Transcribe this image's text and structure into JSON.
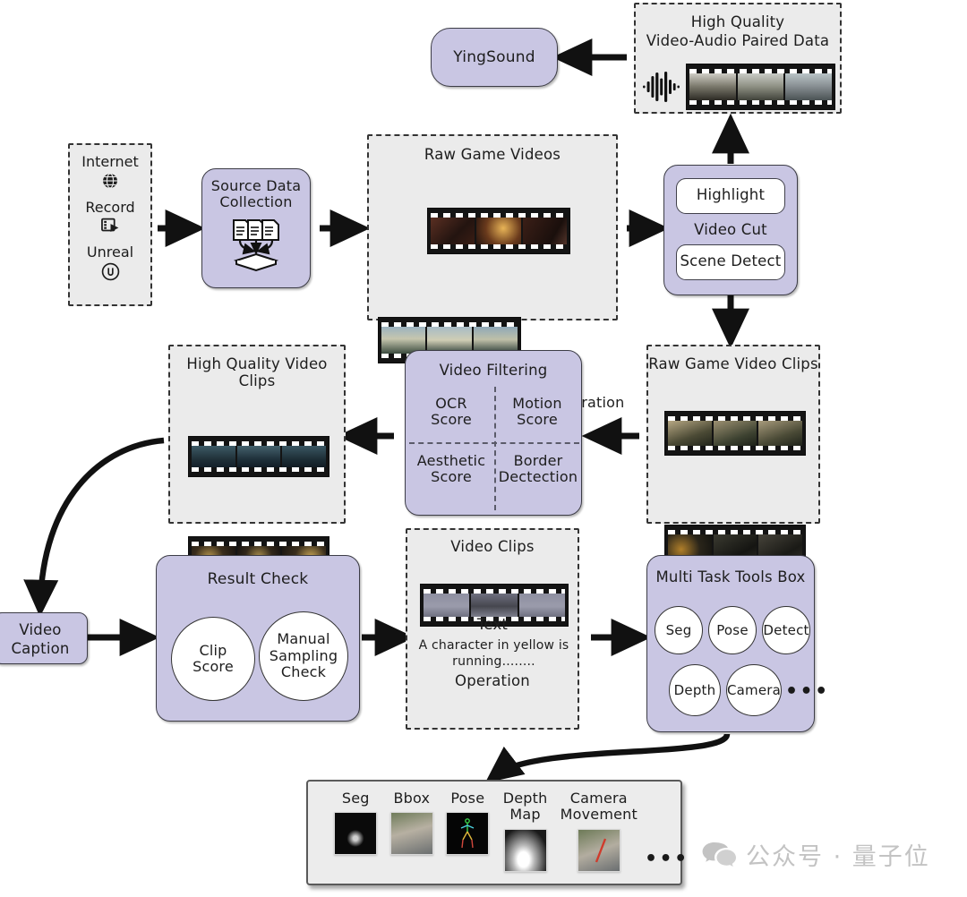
{
  "title": "Game video data production pipeline",
  "colors": {
    "purple": "#c9c6e3",
    "panel_grey": "#ebebeb",
    "stroke": "#333333",
    "text": "#1d1d1d"
  },
  "source_data": {
    "items": [
      {
        "label": "Internet",
        "icon": "globe-icon"
      },
      {
        "label": "Record",
        "icon": "screen-record-icon"
      },
      {
        "label": "Unreal",
        "icon": "unreal-engine-icon"
      }
    ]
  },
  "source_collection": {
    "label_line1": "Source Data",
    "label_line2": "Collection",
    "icon": "documents-to-tray-icon"
  },
  "raw_game_videos": {
    "title": "Raw Game Videos",
    "operation_label": "Operation",
    "operation_icon": "plus-icon"
  },
  "video_cut": {
    "title": "Video Cut",
    "highlight": "Highlight",
    "scene_detect": "Scene Detect"
  },
  "paired_data": {
    "title_line1": "High Quality",
    "title_line2": "Video-Audio Paired Data",
    "audio_icon": "waveform-icon"
  },
  "yingsound": {
    "label": "YingSound"
  },
  "raw_clips": {
    "title": "Raw Game Video Clips"
  },
  "video_filtering": {
    "title": "Video Filtering",
    "cells": [
      {
        "line1": "OCR",
        "line2": "Score"
      },
      {
        "line1": "Motion",
        "line2": "Score"
      },
      {
        "line1": "Aesthetic",
        "line2": "Score"
      },
      {
        "line1": "Border",
        "line2": "Dectection"
      }
    ]
  },
  "hq_clips": {
    "title": "High Quality Video Clips"
  },
  "video_caption": {
    "line1": "Video",
    "line2": "Caption"
  },
  "result_check": {
    "title": "Result Check",
    "circles": [
      {
        "lines": [
          "Clip",
          "Score"
        ]
      },
      {
        "lines": [
          "Manual",
          "Sampling",
          "Check"
        ]
      }
    ]
  },
  "video_clips": {
    "title": "Video Clips",
    "text_heading": "Text",
    "text_body_line1": "A character in yellow  is",
    "text_body_line2": "running........",
    "operation_label": "Operation"
  },
  "multi_task_tools": {
    "title": "Multi Task Tools Box",
    "row1": [
      "Seg",
      "Pose",
      "Detect"
    ],
    "row2": [
      "Depth",
      "Camera"
    ],
    "more": "•••"
  },
  "outputs": {
    "columns": [
      {
        "line1": "Seg",
        "line2": "",
        "thumb": "segmentation-thumb"
      },
      {
        "line1": "Bbox",
        "line2": "",
        "thumb": "bbox-thumb"
      },
      {
        "line1": "Pose",
        "line2": "",
        "thumb": "pose-thumb"
      },
      {
        "line1": "Depth",
        "line2": "Map",
        "thumb": "depth-map-thumb"
      },
      {
        "line1": "Camera",
        "line2": "Movement",
        "thumb": "camera-movement-thumb"
      }
    ],
    "more": "•••"
  },
  "watermark": {
    "text": "公众号 · 量子位",
    "icon": "wechat-icon"
  }
}
